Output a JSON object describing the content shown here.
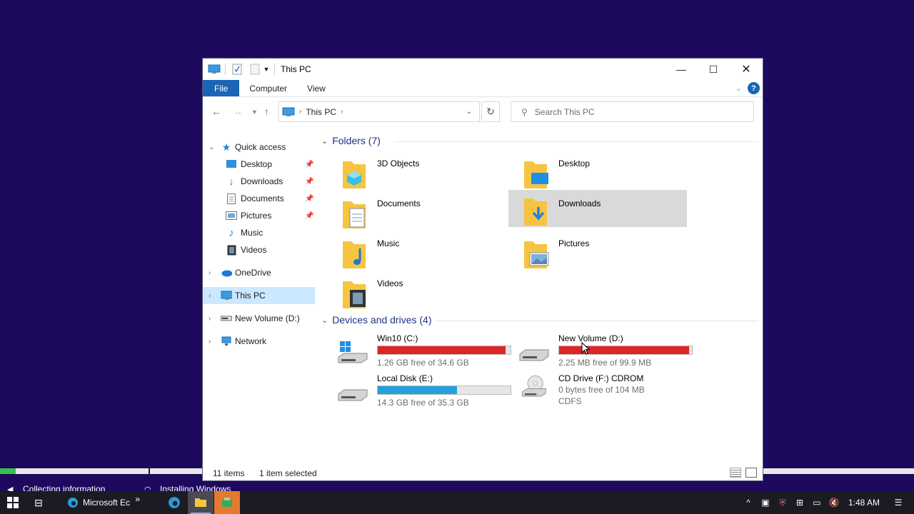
{
  "setup": {
    "progress": 0.017,
    "status1": "Collecting information",
    "status2": "Installing Windows"
  },
  "window": {
    "title": "This PC",
    "ribbon_tabs": [
      "File",
      "Computer",
      "View"
    ],
    "address_crumb": "This PC",
    "search_placeholder": "Search This PC"
  },
  "nav": {
    "quick_access": "Quick access",
    "items": [
      {
        "label": "Desktop",
        "icon": "desktop-icon",
        "pinned": true
      },
      {
        "label": "Downloads",
        "icon": "downloads-icon",
        "pinned": true
      },
      {
        "label": "Documents",
        "icon": "documents-icon",
        "pinned": true
      },
      {
        "label": "Pictures",
        "icon": "pictures-icon",
        "pinned": true
      },
      {
        "label": "Music",
        "icon": "music-icon",
        "pinned": false
      },
      {
        "label": "Videos",
        "icon": "videos-icon",
        "pinned": false
      }
    ],
    "onedrive": "OneDrive",
    "this_pc": "This PC",
    "new_volume": "New Volume (D:)",
    "network": "Network"
  },
  "folders": {
    "header": "Folders (7)",
    "items": [
      "3D Objects",
      "Desktop",
      "Documents",
      "Downloads",
      "Music",
      "Pictures",
      "Videos"
    ]
  },
  "drives": {
    "header": "Devices and drives (4)",
    "items": [
      {
        "name": "Win10 (C:)",
        "free": "1.26 GB free of 34.6 GB",
        "used_fraction": 0.964,
        "bar_color": "#da2626"
      },
      {
        "name": "New Volume (D:)",
        "free": "2.25 MB free of 99.9 MB",
        "used_fraction": 0.978,
        "bar_color": "#da2626"
      },
      {
        "name": "Local Disk (E:)",
        "free": "14.3 GB free of 35.3 GB",
        "used_fraction": 0.595,
        "bar_color": "#26a0da"
      },
      {
        "name": "CD Drive (F:) CDROM",
        "free": "0 bytes free of 104 MB",
        "fs": "CDFS"
      }
    ]
  },
  "status": {
    "count": "11 items",
    "selected": "1 item selected"
  },
  "taskbar": {
    "edge_label": "Microsoft Ec",
    "overflow": "»",
    "clock": "1:48 AM"
  }
}
